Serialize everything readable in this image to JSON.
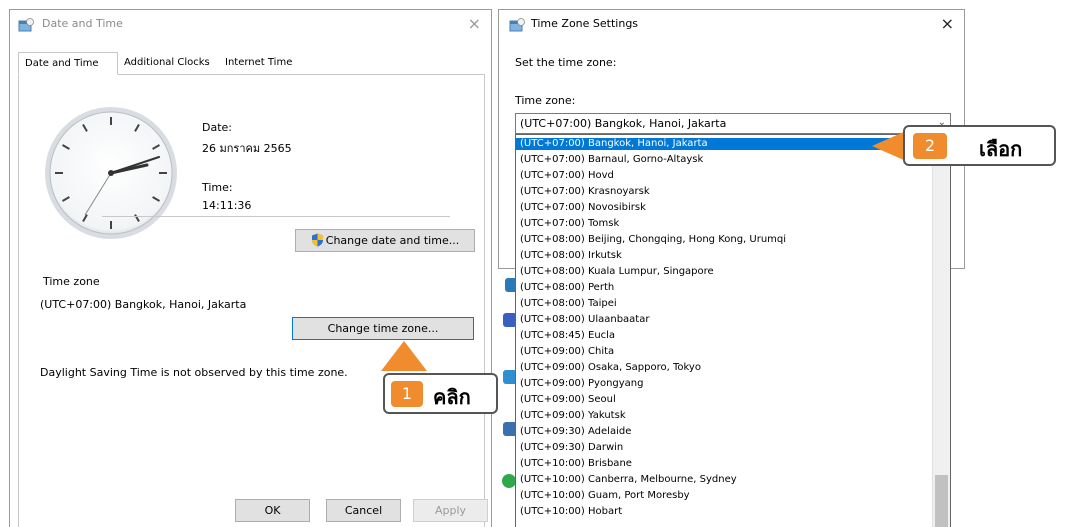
{
  "date_time_window": {
    "title": "Date and Time",
    "close_glyph": "×",
    "tabs": [
      {
        "label": "Date and Time",
        "active": true
      },
      {
        "label": "Additional Clocks",
        "active": false
      },
      {
        "label": "Internet Time",
        "active": false
      }
    ],
    "date_label": "Date:",
    "date_value": "26 มกราคม 2565",
    "time_label": "Time:",
    "time_value": "14:11:36",
    "change_datetime_button": "Change date and time...",
    "time_zone_heading": "Time zone",
    "current_time_zone": "(UTC+07:00) Bangkok, Hanoi, Jakarta",
    "change_timezone_button": "Change time zone...",
    "dst_note": "Daylight Saving Time is not observed by this time zone.",
    "ok_button": "OK",
    "cancel_button": "Cancel",
    "apply_button": "Apply"
  },
  "time_zone_window": {
    "title": "Time Zone Settings",
    "close_glyph": "×",
    "instruction": "Set the time zone:",
    "time_zone_label": "Time zone:",
    "combo_value": "(UTC+07:00) Bangkok, Hanoi, Jakarta",
    "dropdown_items": [
      "(UTC+07:00) Bangkok, Hanoi, Jakarta",
      "(UTC+07:00) Barnaul, Gorno-Altaysk",
      "(UTC+07:00) Hovd",
      "(UTC+07:00) Krasnoyarsk",
      "(UTC+07:00) Novosibirsk",
      "(UTC+07:00) Tomsk",
      "(UTC+08:00) Beijing, Chongqing, Hong Kong, Urumqi",
      "(UTC+08:00) Irkutsk",
      "(UTC+08:00) Kuala Lumpur, Singapore",
      "(UTC+08:00) Perth",
      "(UTC+08:00) Taipei",
      "(UTC+08:00) Ulaanbaatar",
      "(UTC+08:45) Eucla",
      "(UTC+09:00) Chita",
      "(UTC+09:00) Osaka, Sapporo, Tokyo",
      "(UTC+09:00) Pyongyang",
      "(UTC+09:00) Seoul",
      "(UTC+09:00) Yakutsk",
      "(UTC+09:30) Adelaide",
      "(UTC+09:30) Darwin",
      "(UTC+10:00) Brisbane",
      "(UTC+10:00) Canberra, Melbourne, Sydney",
      "(UTC+10:00) Guam, Port Moresby",
      "(UTC+10:00) Hobart"
    ],
    "selected_index": 0
  },
  "annotations": {
    "step1_number": "1",
    "step1_word": "คลิก",
    "step2_number": "2",
    "step2_word": "เลือก",
    "accent_color": "#f08c2e"
  },
  "colors": {
    "selection": "#0078d7",
    "button_face": "#e1e1e1",
    "focus_border": "#0078d7"
  }
}
